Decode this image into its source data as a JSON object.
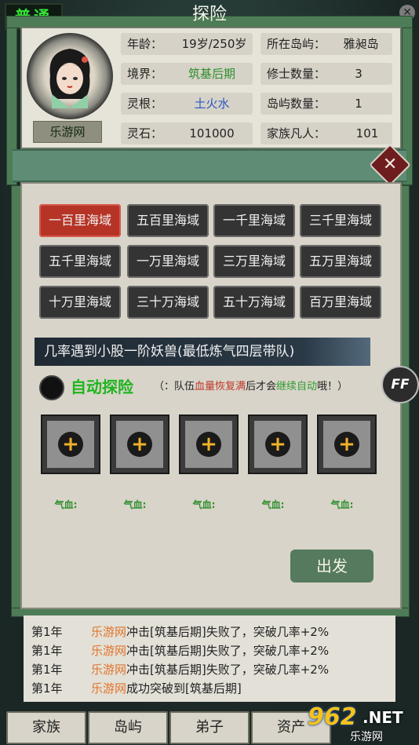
{
  "mode": "普通",
  "character": {
    "name": "乐游网",
    "stats": [
      {
        "key": "年龄：",
        "value": "19岁/250岁"
      },
      {
        "key": "所在岛屿：",
        "value": "雅昶岛"
      },
      {
        "key": "境界：",
        "value": "筑基后期"
      },
      {
        "key": "修士数量：",
        "value": "3"
      },
      {
        "key": "灵根：",
        "value": "土火水"
      },
      {
        "key": "岛屿数量：",
        "value": "1"
      },
      {
        "key": "灵石：",
        "value": "101000"
      },
      {
        "key": "家族凡人：",
        "value": "101"
      }
    ]
  },
  "panel": {
    "title": "探险",
    "close_label": "✕",
    "regions": [
      "一百里海域",
      "五百里海域",
      "一千里海域",
      "三千里海域",
      "五千里海域",
      "一万里海域",
      "三万里海域",
      "五万里海域",
      "十万里海域",
      "三十万海域",
      "五十万海域",
      "百万里海域"
    ],
    "selected_region": "一百里海域",
    "info": "几率遇到小股一阶妖兽(最低炼气四层带队)",
    "auto_label": "自动探险",
    "auto_note": {
      "p1": "（：队伍",
      "p2": "血量恢复满",
      "p3": "后才会",
      "p4": "继续自动",
      "p5": "哦！）"
    },
    "ff_label": "FF",
    "slot_plus": "+",
    "hp_label": "气血:",
    "slots": 5,
    "go_label": "出发"
  },
  "log": [
    {
      "year": "第1年",
      "who": "乐游网",
      "text": "冲击[筑基后期]失败了，突破几率+2%"
    },
    {
      "year": "第1年",
      "who": "乐游网",
      "text": "冲击[筑基后期]失败了，突破几率+2%"
    },
    {
      "year": "第1年",
      "who": "乐游网",
      "text": "冲击[筑基后期]失败了，突破几率+2%"
    },
    {
      "year": "第1年",
      "who": "乐游网",
      "text": "成功突破到[筑基后期]"
    }
  ],
  "nav": [
    "家族",
    "岛屿",
    "弟子",
    "资产"
  ],
  "watermark": {
    "num": "962",
    "net": ".NET",
    "sub": "乐游网"
  },
  "colors": {
    "accent_green": "#5e8c74",
    "selected_red": "#b53426",
    "button_dark": "#343434",
    "paper": "#d8d4c9"
  }
}
